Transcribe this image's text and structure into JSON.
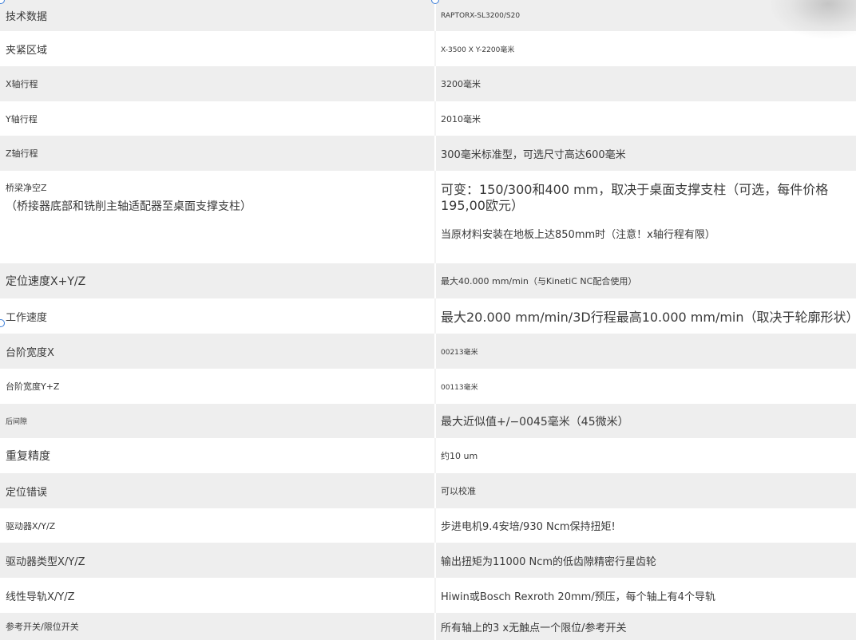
{
  "rows": [
    {
      "label": "技术数据",
      "value": "RAPTORX-SL3200/S20"
    },
    {
      "label": "夹紧区域",
      "value": "X-3500 X Y-2200毫米"
    },
    {
      "label": "X轴行程",
      "value": "3200毫米"
    },
    {
      "label": "Y轴行程",
      "value": "2010毫米"
    },
    {
      "label": "Z轴行程",
      "value": "300毫米标准型，可选尺寸高达600毫米"
    },
    {
      "label": "桥梁净空Z",
      "label2": "（桥接器底部和铣削主轴适配器至桌面支撑支柱）",
      "value": "可变：150/300和400 mm，取决于桌面支撑支柱（可选，每件价格195,00欧元）",
      "value2": "当原材料安装在地板上达850mm时（注意！x轴行程有限）"
    },
    {
      "label": "定位速度X+Y/Z",
      "value": "最大40.000 mm/min（与KinetiC NC配合使用）"
    },
    {
      "label": "工作速度",
      "value": "最大20.000 mm/min/3D行程最高10.000 mm/min（取决于轮廓形状）"
    },
    {
      "label": "台阶宽度X",
      "value": "00213毫米"
    },
    {
      "label": "台阶宽度Y+Z",
      "value": "00113毫米"
    },
    {
      "label": "后间隙",
      "value": "最大近似值+/−0045毫米（45微米）"
    },
    {
      "label": "重复精度",
      "value": "约10 um"
    },
    {
      "label": "定位错误",
      "value": "可以校准"
    },
    {
      "label": "驱动器X/Y/Z",
      "value": "步进电机9.4安培/930 Ncm保持扭矩!"
    },
    {
      "label": "驱动器类型X/Y/Z",
      "value": "输出扭矩为11000 Ncm的低齿隙精密行星齿轮"
    },
    {
      "label": "线性导轨X/Y/Z",
      "value": "Hiwin或Bosch Rexroth 20mm/预压，每个轴上有4个导轨"
    },
    {
      "label": "参考开关/限位开关",
      "value": "所有轴上的3 x无触点一个限位/参考开关"
    }
  ]
}
